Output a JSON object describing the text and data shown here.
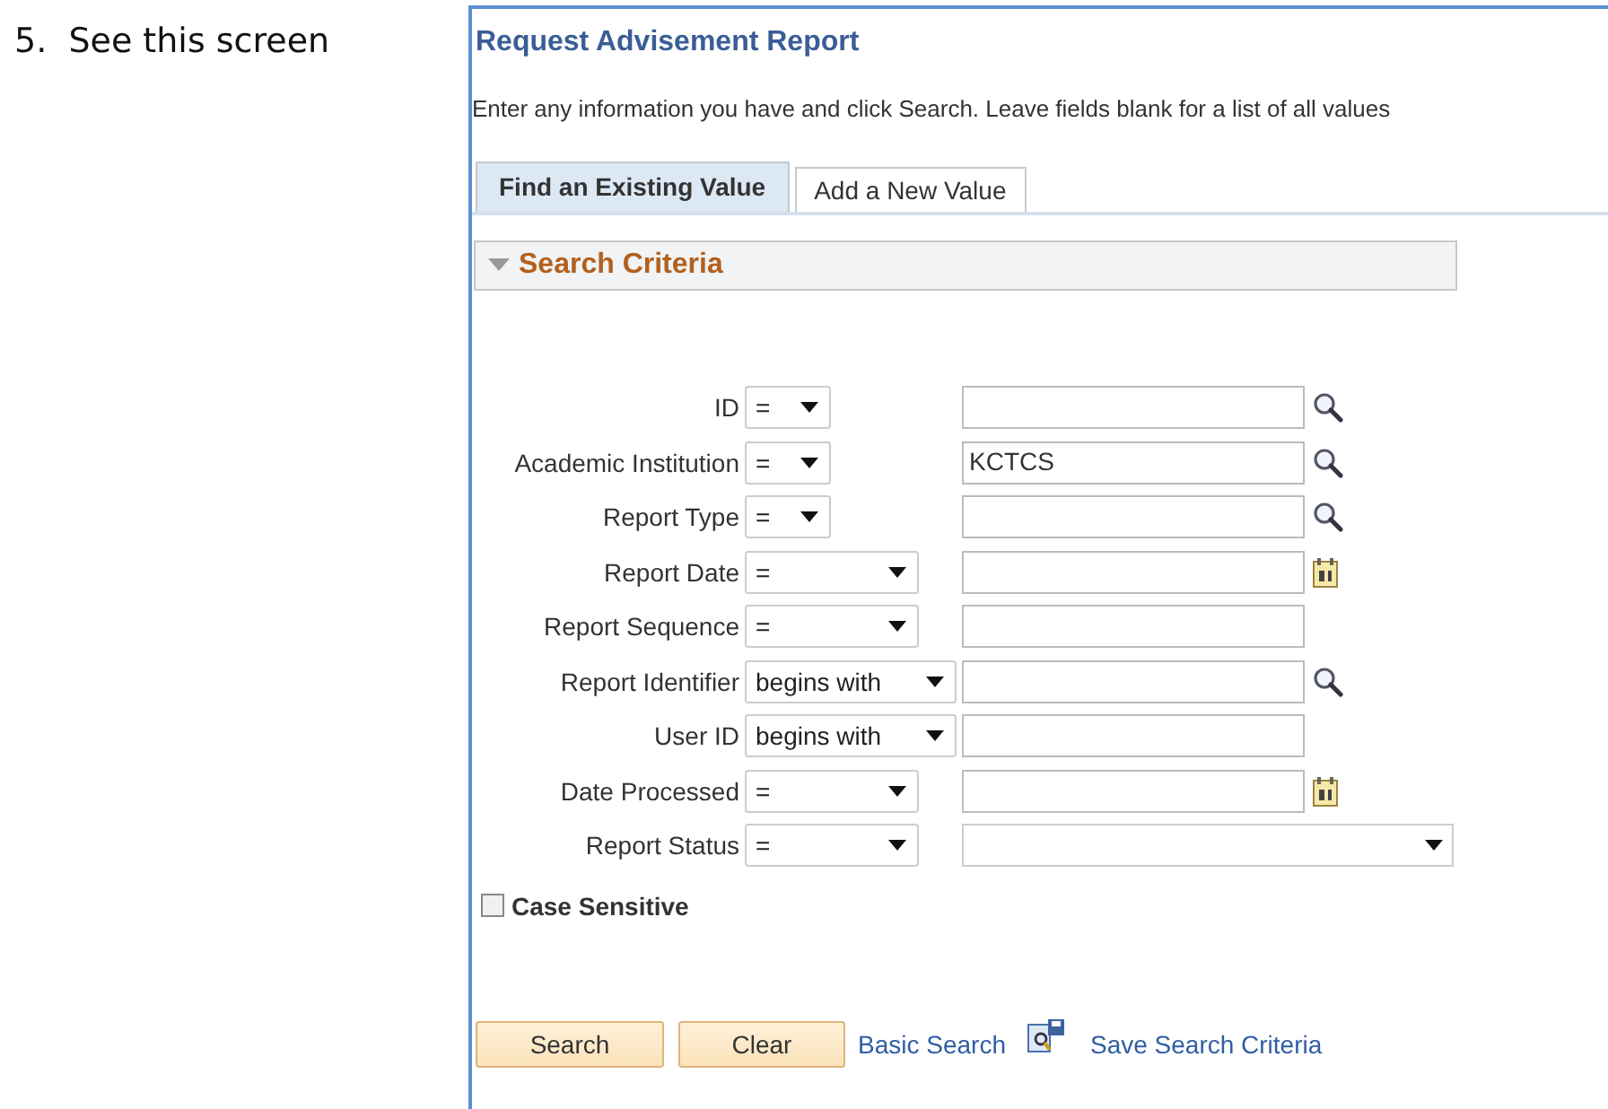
{
  "document_text": "5.  See this screen",
  "page": {
    "title": "Request Advisement Report",
    "instructions": "Enter any information you have and click Search. Leave fields blank for a list of all values",
    "tabs": [
      {
        "label": "Find an Existing Value",
        "selected": true
      },
      {
        "label": "Add a New Value",
        "selected": false
      }
    ],
    "section": {
      "title": "Search Criteria",
      "expanded": true
    },
    "criteria": [
      {
        "label": "ID",
        "operator": "=",
        "kind": "lookup"
      },
      {
        "label": "Academic Institution",
        "operator": "=",
        "value": "KCTCS",
        "kind": "lookup"
      },
      {
        "label": "Report Type",
        "operator": "=",
        "kind": "lookup"
      },
      {
        "label": "Report Date",
        "operator": "=",
        "kind": "date"
      },
      {
        "label": "Report Sequence",
        "operator": "=",
        "kind": "plain"
      },
      {
        "label": "Report Identifier",
        "operator": "begins with",
        "kind": "lookup"
      },
      {
        "label": "User ID",
        "operator": "begins with",
        "kind": "plain"
      },
      {
        "label": "Date Processed",
        "operator": "=",
        "kind": "date"
      },
      {
        "label": "Report Status",
        "operator": "=",
        "kind": "select"
      }
    ],
    "case_sensitive": {
      "label": "Case Sensitive",
      "checked": false
    },
    "buttons": [
      "Search",
      "Clear"
    ],
    "links": [
      {
        "label": "Basic Search",
        "kind": "plain"
      },
      {
        "label": "Save Search Criteria",
        "kind": "save"
      }
    ]
  }
}
